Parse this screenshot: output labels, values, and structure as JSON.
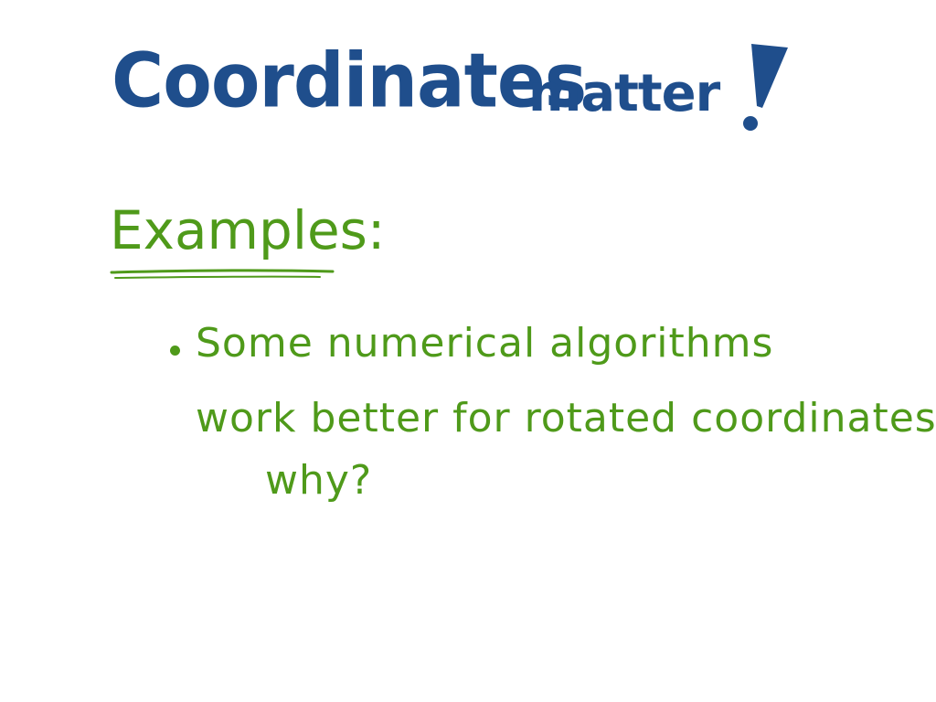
{
  "colors": {
    "background": "#ffffff",
    "title": "#1f4e8c",
    "body": "#4f9a1a"
  },
  "slide": {
    "title_word_1": "Coordinates",
    "title_word_2": "matter",
    "title_punctuation": "!",
    "heading": "Examples:",
    "bullet_line_1": "Some numerical algorithms",
    "bullet_line_2": "work better for rotated coordinates,",
    "bullet_line_3": "why?"
  }
}
